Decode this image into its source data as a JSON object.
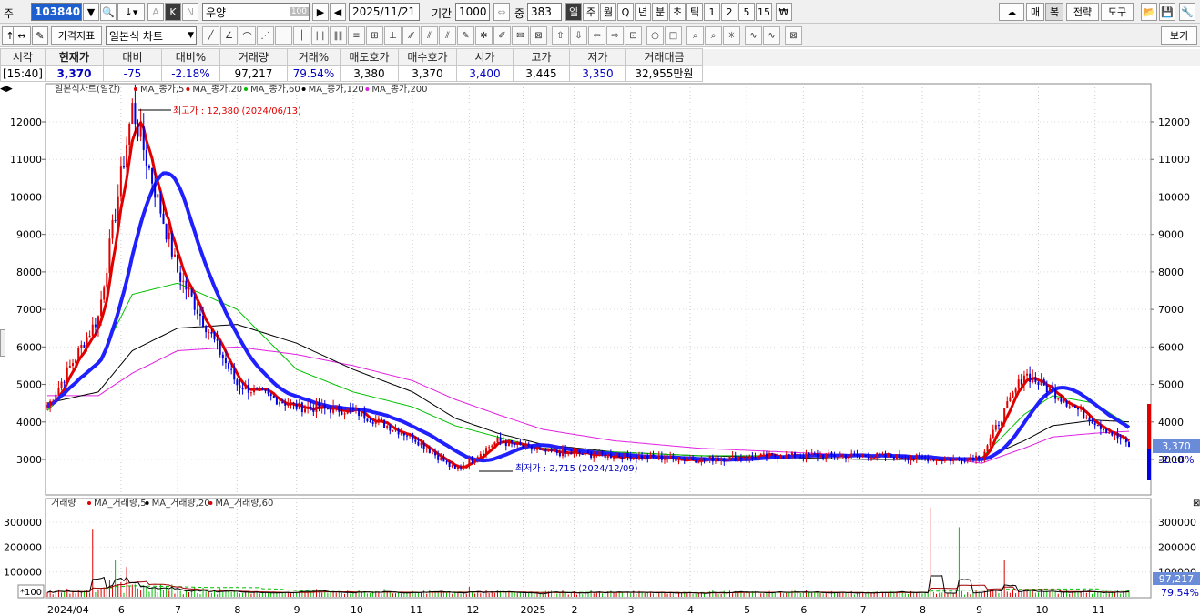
{
  "toolbar1": {
    "market_label": "주",
    "code": "103840",
    "stock_name": "우양",
    "stock_name_badge": "100",
    "date": "2025/11/21",
    "period_label": "기간",
    "period_value": "1000",
    "count_label": "중",
    "count_value": "383",
    "k_label": "K",
    "n_label": "N",
    "a_label": "A",
    "interval_buttons": [
      "일",
      "주",
      "월",
      "Q",
      "년",
      "분",
      "초",
      "틱",
      "1",
      "2",
      "5",
      "15",
      "₩"
    ],
    "right_buttons": [
      "매",
      "복",
      "전략",
      "도구"
    ]
  },
  "toolbar2": {
    "price_indicator_label": "가격지표",
    "chart_type": "일본식 차트",
    "view_button": "보기"
  },
  "quote": {
    "headers": [
      "시각",
      "현재가",
      "대비",
      "대비%",
      "거래량",
      "거래%",
      "매도호가",
      "매수호가",
      "시가",
      "고가",
      "저가",
      "거래대금"
    ],
    "values": [
      "[15:40]",
      "3,370",
      "-75",
      "-2.18%",
      "97,217",
      "79.54%",
      "3,380",
      "3,370",
      "3,400",
      "3,445",
      "3,350",
      "32,955만원"
    ]
  },
  "price_panel": {
    "title": "일본식차트(일간)",
    "legend": [
      {
        "label": "MA_종가,5",
        "color": "#e00000"
      },
      {
        "label": "MA_종가,20",
        "color": "#e00000"
      },
      {
        "label": "MA_종가,60",
        "color": "#00c000"
      },
      {
        "label": "MA_종가,120",
        "color": "#000000"
      },
      {
        "label": "MA_종가,200",
        "color": "#e020e0"
      }
    ],
    "max_annotation": "최고가 : 12,380 (2024/06/13)",
    "min_annotation": "최저가 : 2,715 (2024/12/09)",
    "y_ticks": [
      3000,
      4000,
      5000,
      6000,
      7000,
      8000,
      9000,
      10000,
      11000,
      12000
    ],
    "current_price_tag": "3,370",
    "current_change_tag": "-2.18%"
  },
  "volume_panel": {
    "legend_title": "거래량",
    "legend": [
      {
        "label": "MA_거래량,5",
        "color": "#e00000"
      },
      {
        "label": "MA_거래량,20",
        "color": "#000000"
      },
      {
        "label": "MA_거래량,60",
        "color": "#e00000"
      }
    ],
    "y_ticks": [
      100000,
      200000,
      300000
    ],
    "y_tick_labels": [
      "100000",
      "200000",
      "300000"
    ],
    "multiplier_label": "*100",
    "current_volume_tag": "97,217",
    "current_ratio_tag": "79.54%"
  },
  "x_axis": {
    "labels": [
      "2024/04",
      "6",
      "7",
      "8",
      "9",
      "10",
      "11",
      "12",
      "2025",
      "2",
      "3",
      "4",
      "5",
      "6",
      "7",
      "8",
      "9",
      "10",
      "11"
    ]
  },
  "colors": {
    "up": "#e00000",
    "down": "#0000e0",
    "ma20": "#2020ff",
    "ma60": "#00c000",
    "ma120": "#000000",
    "ma200": "#e020e0"
  },
  "chart_data": {
    "type": "candlestick",
    "title": "일본식차트(일간)",
    "x": [
      "2024/04",
      "2024/05",
      "2024/06/13",
      "2024/07",
      "2024/08",
      "2024/09",
      "2024/10",
      "2024/11",
      "2024/12/09",
      "2024/12",
      "2025/01",
      "2025/02",
      "2025/03",
      "2025/04",
      "2025/05",
      "2025/06",
      "2025/07",
      "2025/08",
      "2025/09",
      "2025/10",
      "2025/11/21"
    ],
    "close_approx": [
      4400,
      6800,
      12380,
      8000,
      5000,
      4400,
      4300,
      3600,
      2715,
      3500,
      3200,
      3100,
      3000,
      3100,
      3100,
      3000,
      3100,
      5300,
      4800,
      4000,
      3370
    ],
    "ma60_approx": [
      4300,
      5600,
      7400,
      7700,
      7000,
      5400,
      4800,
      4400,
      3900,
      3600,
      3300,
      3200,
      3100,
      3100,
      3100,
      3000,
      3050,
      4200,
      4700,
      4500,
      3900
    ],
    "ma120_approx": [
      4500,
      4800,
      5900,
      6500,
      6600,
      6100,
      5400,
      4800,
      4100,
      3700,
      3400,
      3200,
      3100,
      3050,
      3000,
      3000,
      3000,
      3500,
      3900,
      4050,
      4000
    ],
    "ma200_approx": [
      4700,
      4700,
      5300,
      5900,
      6000,
      5800,
      5500,
      5100,
      4600,
      4200,
      3800,
      3500,
      3300,
      3200,
      3100,
      3000,
      2900,
      3300,
      3600,
      3700,
      3750
    ],
    "ylim": [
      2500,
      12500
    ],
    "y_ticks": [
      3000,
      4000,
      5000,
      6000,
      7000,
      8000,
      9000,
      10000,
      11000,
      12000
    ],
    "volume_series": [
      {
        "name": "거래량",
        "x": [
          "2024/05",
          "2024/06",
          "2024/12",
          "2025/08",
          "2025/09"
        ],
        "values": [
          270000,
          150000,
          40000,
          360000,
          150000
        ]
      }
    ],
    "volume_ylim": [
      0,
      350000
    ],
    "volume_y_ticks": [
      100000,
      200000,
      300000
    ]
  }
}
